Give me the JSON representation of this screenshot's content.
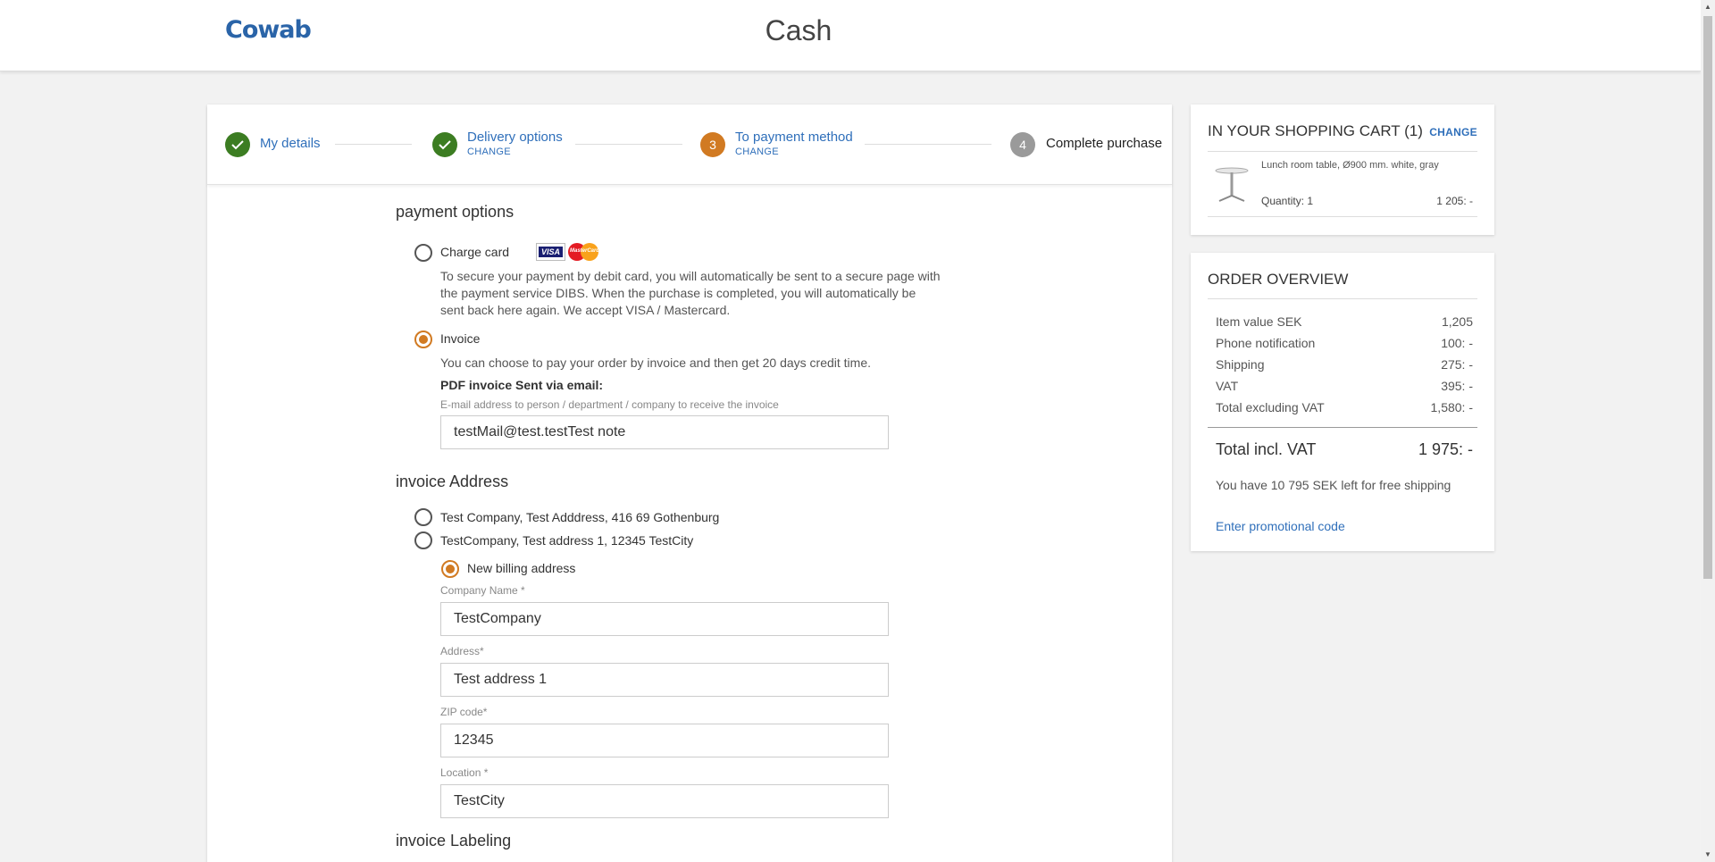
{
  "header": {
    "logo": "Cowab",
    "title": "Cash"
  },
  "steps": [
    {
      "number": "",
      "label": "My details",
      "change": "",
      "state": "done"
    },
    {
      "number": "",
      "label": "Delivery options",
      "change": "CHANGE",
      "state": "done"
    },
    {
      "number": "3",
      "label": "To payment method",
      "change": "CHANGE",
      "state": "current"
    },
    {
      "number": "4",
      "label": "Complete purchase",
      "change": "",
      "state": "todo"
    }
  ],
  "payment": {
    "title": "payment options",
    "charge_card": {
      "label": "Charge card",
      "selected": false,
      "description": "To secure your payment by debit card, you will automatically be sent to a secure page with the payment service DIBS. When the purchase is completed, you will automatically be sent back here again. We accept VISA / Mastercard.",
      "visa_text": "VISA",
      "mc_text": "MasterCard"
    },
    "invoice": {
      "label": "Invoice",
      "selected": true,
      "description": "You can choose to pay your order by invoice and then get 20 days credit time.",
      "pdf_label": "PDF invoice Sent via email:",
      "email_hint": "E-mail address to person / department / company to receive the invoice",
      "email_value": "testMail@test.testTest note"
    }
  },
  "invoice_address": {
    "title": "invoice Address",
    "options": [
      {
        "label": "Test Company, Test Adddress, 416 69 Gothenburg",
        "selected": false
      },
      {
        "label": "TestCompany, Test address 1, 12345 TestCity",
        "selected": false
      }
    ],
    "new_billing": {
      "label": "New billing address",
      "selected": true
    },
    "fields": {
      "company_label": "Company Name *",
      "company_value": "TestCompany",
      "address_label": "Address*",
      "address_value": "Test address 1",
      "zip_label": "ZIP code*",
      "zip_value": "12345",
      "location_label": "Location *",
      "location_value": "TestCity"
    }
  },
  "invoice_labeling": {
    "title": "invoice Labeling"
  },
  "cart": {
    "title": "IN YOUR SHOPPING CART (1)",
    "change": "CHANGE",
    "item": {
      "name": "Lunch room table, Ø900 mm. white, gray",
      "quantity": "Quantity: 1",
      "price": "1 205: -"
    }
  },
  "overview": {
    "title": "ORDER OVERVIEW",
    "rows": [
      {
        "label": "Item value SEK",
        "value": "1,205"
      },
      {
        "label": "Phone notification",
        "value": "100: -"
      },
      {
        "label": "Shipping",
        "value": "275: -"
      },
      {
        "label": "VAT",
        "value": "395: -"
      },
      {
        "label": "Total excluding VAT",
        "value": "1,580: -"
      }
    ],
    "total_label": "Total incl. VAT",
    "total_value": "1 975: -",
    "free_shipping": "You have 10 795 SEK left for free shipping",
    "promo": "Enter promotional code"
  },
  "colors": {
    "brand": "#2a64a8",
    "done": "#3c7d22",
    "current": "#d17a22",
    "todo": "#9a9a9a",
    "link": "#2f6fba"
  }
}
